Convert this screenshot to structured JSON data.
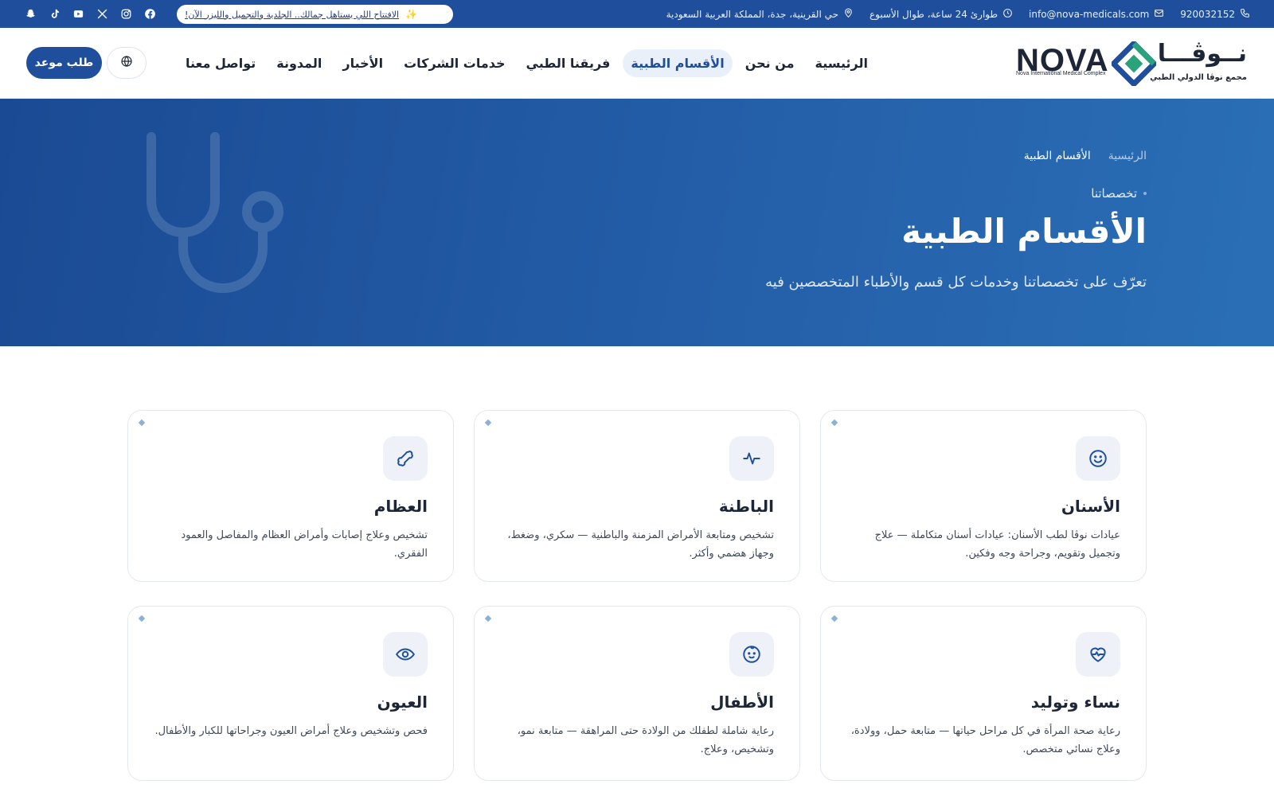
{
  "topbar": {
    "phone": "920032152",
    "email": "info@nova-medicals.com",
    "hours": "طوارئ 24 ساعة، طوال الأسبوع",
    "address": "حي القرينية، جدة، المملكة العربية السعودية",
    "promo": "الافتتاح اللي يستاهل جمالك.. الجلدية والتجميل والليزر الآن!",
    "promo_icon": "sparkle-icon",
    "social_icons": [
      "facebook-icon",
      "instagram-icon",
      "x-icon",
      "youtube-icon",
      "tiktok-icon",
      "snapchat-icon"
    ]
  },
  "logo": {
    "latin": "NOVA",
    "latin_sub": "Nova International Medical Complex",
    "arabic": "نــوڤـــا",
    "arabic_sub": "مجمع نوڤا الدولي الطبي",
    "colors": {
      "diamond_blue": "#1f4f9c",
      "diamond_green": "#2aa37a"
    }
  },
  "nav": {
    "items": [
      {
        "label": "الرئيسية",
        "active": false
      },
      {
        "label": "من نحن",
        "active": false
      },
      {
        "label": "الأقسام الطبية",
        "active": true
      },
      {
        "label": "فريقنا الطبي",
        "active": false
      },
      {
        "label": "خدمات الشركات",
        "active": false
      },
      {
        "label": "الأخبار",
        "active": false
      },
      {
        "label": "المدونة",
        "active": false
      },
      {
        "label": "تواصل معنا",
        "active": false
      }
    ],
    "language_icon": "globe-icon",
    "cta": "طلب موعد"
  },
  "hero": {
    "breadcrumb_home": "الرئيسية",
    "breadcrumb_current": "الأقسام الطبية",
    "eyebrow": "تخصصاتنا",
    "title": "الأقسام الطبية",
    "subtitle": "تعرّف على تخصصاتنا وخدمات كل قسم والأطباء المتخصصين فيه",
    "decor_icon": "stethoscope-icon"
  },
  "departments": [
    {
      "title": "الأسنان",
      "icon": "smile-icon",
      "description": "عيادات نوڤا لطب الأسنان: عيادات أسنان متكاملة — علاج وتجميل وتقويم، وجراحة وجه وفكين."
    },
    {
      "title": "الباطنة",
      "icon": "pulse-icon",
      "description": "تشخيص ومتابعة الأمراض المزمنة والباطنية — سكري، وضغط، وجهاز هضمي وأكثر."
    },
    {
      "title": "العظام",
      "icon": "bone-icon",
      "description": "تشخيص وعلاج إصابات وأمراض العظام والمفاصل والعمود الفقري."
    },
    {
      "title": "نساء وتوليد",
      "icon": "heart-pulse-icon",
      "description": "رعاية صحة المرأة في كل مراحل حياتها — متابعة حمل، وولادة، وعلاج نسائي متخصص."
    },
    {
      "title": "الأطفال",
      "icon": "baby-icon",
      "description": "رعاية شاملة لطفلك من الولادة حتى المراهقة — متابعة نمو، وتشخيص، وعلاج."
    },
    {
      "title": "العيون",
      "icon": "eye-icon",
      "description": "فحص وتشخيص وعلاج أمراض العيون وجراحاتها للكبار والأطفال."
    }
  ]
}
